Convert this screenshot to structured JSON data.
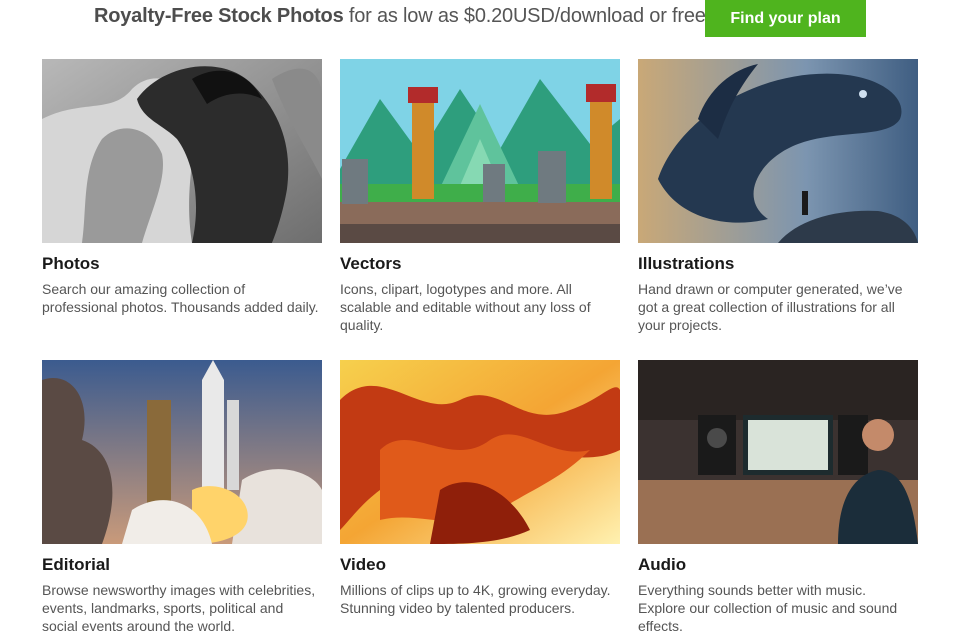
{
  "banner": {
    "strong": "Royalty-Free Stock Photos",
    "rest": " for as low as $0.20USD/download or free",
    "cta_label": "Find your plan"
  },
  "colors": {
    "cta": "#4fb41e",
    "title": "#1a1a1a",
    "body": "#555555"
  },
  "cards": [
    {
      "title": "Photos",
      "desc": "Search our amazing collection of professional photos. Thousands added daily.",
      "image": "black-and-white-horses"
    },
    {
      "title": "Vectors",
      "desc": "Icons, clipart, logotypes and more. All scalable and editable without any loss of quality.",
      "image": "pixel-art-temple-statues"
    },
    {
      "title": "Illustrations",
      "desc": "Hand drawn or computer generated, we’ve got a great collection of illustrations for all your projects.",
      "image": "giant-fish-sky-illustration"
    },
    {
      "title": "Editorial",
      "desc": "Browse newsworthy images with celebrities, events, landmarks, sports, political and social events around the world.",
      "image": "space-shuttle-launch"
    },
    {
      "title": "Video",
      "desc": "Millions of clips up to 4K, growing everyday. Stunning video by talented producers.",
      "image": "orange-ink-swirl"
    },
    {
      "title": "Audio",
      "desc": "Everything sounds better with music. Explore our collection of music and sound effects.",
      "image": "music-studio"
    }
  ]
}
